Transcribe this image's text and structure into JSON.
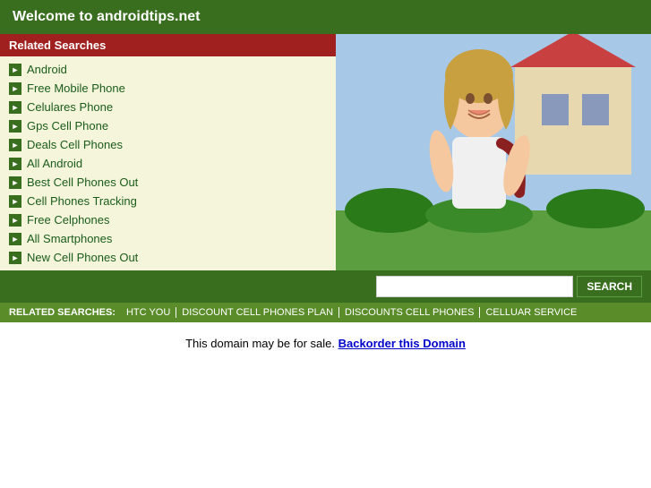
{
  "header": {
    "title": "Welcome to androidtips.net"
  },
  "sidebar": {
    "related_searches_label": "Related Searches",
    "links": [
      {
        "label": "Android"
      },
      {
        "label": "Free Mobile Phone"
      },
      {
        "label": "Celulares Phone"
      },
      {
        "label": "Gps Cell Phone"
      },
      {
        "label": "Deals Cell Phones"
      },
      {
        "label": "All Android"
      },
      {
        "label": "Best Cell Phones Out"
      },
      {
        "label": "Cell Phones Tracking"
      },
      {
        "label": "Free Celphones"
      },
      {
        "label": "All Smartphones"
      },
      {
        "label": "New Cell Phones Out"
      }
    ]
  },
  "search": {
    "placeholder": "",
    "button_label": "SEARCH"
  },
  "related_bar": {
    "label": "RELATED SEARCHES:",
    "links": [
      {
        "label": "HTC YOU"
      },
      {
        "label": "DISCOUNT CELL PHONES PLAN"
      },
      {
        "label": "DISCOUNTS CELL PHONES"
      },
      {
        "label": "CELLUAR SERVICE"
      }
    ]
  },
  "footer": {
    "text": "This domain may be for sale.",
    "link_text": "Backorder this Domain"
  },
  "colors": {
    "green_dark": "#3a6e1f",
    "red_dark": "#a02020",
    "green_mid": "#5a8c2a",
    "link_green": "#1a5c1a"
  }
}
